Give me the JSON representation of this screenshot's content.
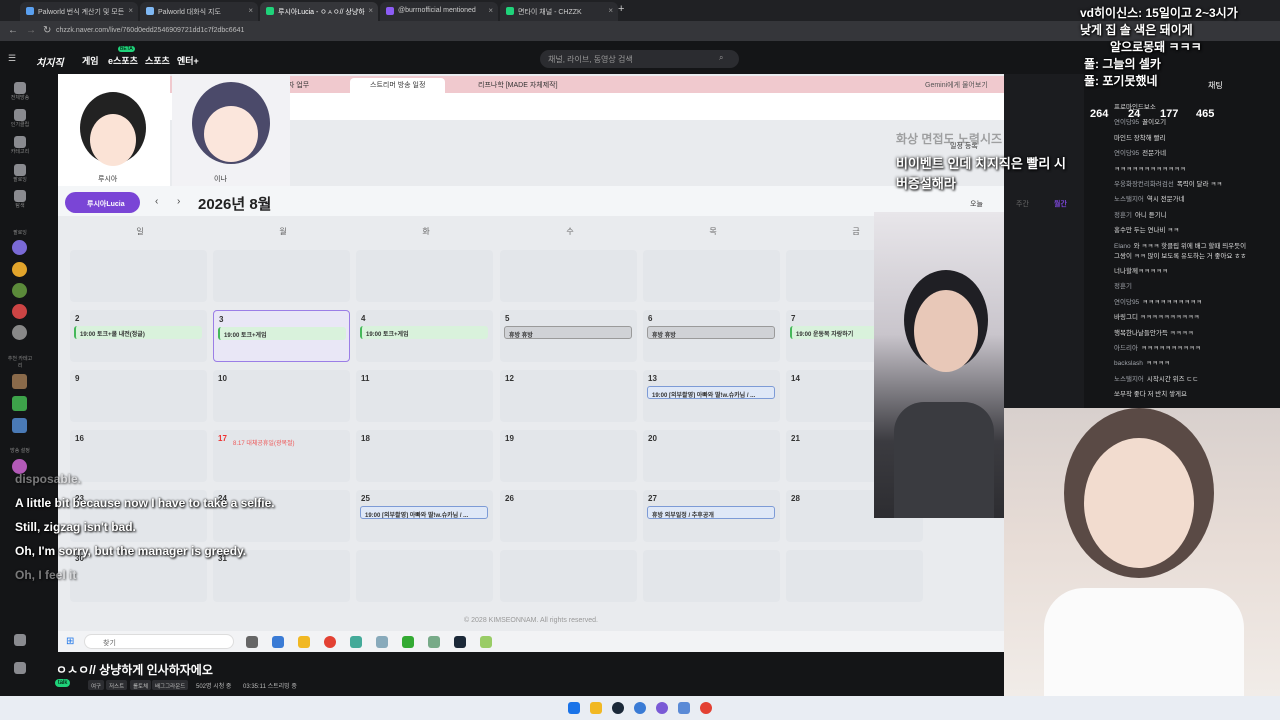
{
  "browser": {
    "tabs": [
      {
        "label": "Palworld 번식 계산기 및 모든",
        "color": "#5aa0f0"
      },
      {
        "label": "Palworld 대화식 지도",
        "color": "#7fb8f4"
      },
      {
        "label": "루시아Lucia - ㅇㅅㅇ// 상냥하",
        "color": "#1fd37a",
        "active": true
      },
      {
        "label": "@burrnofficial mentioned",
        "color": "#8c5cf5"
      },
      {
        "label": "면타이 채널 - CHZZK",
        "color": "#1fd37a"
      }
    ],
    "url": "chzzk.naver.com/live/760d0edd2546909721dd1c7f2dbc6641",
    "new_tab": "+"
  },
  "nav": {
    "logo": "치지직",
    "items": [
      "게임",
      "e스포츠",
      "스포츠",
      "엔터+"
    ],
    "beta_badge": "BETA",
    "search_placeholder": "채널, 라이브, 동영상 검색"
  },
  "rail": {
    "items": [
      "전체방송",
      "인기클립",
      "카테고리",
      "팔로잉",
      "탐색"
    ],
    "section_follow": "팔로잉",
    "section_rec": "추천 카테고리",
    "section_channel": "방송 설정"
  },
  "video": {
    "browser_tabs": [
      "협업자 업무",
      "스트리머 방송 일정",
      "리프나학 [MADE 자체제작]"
    ],
    "gemini_btn": "Gemini에게 물어보기",
    "char_labels": [
      "루시아",
      "이나"
    ],
    "user_pill": "루시아Lucia",
    "month": "2026년 8월",
    "view_buttons": [
      "주간",
      "월간"
    ],
    "today_btn": "오늘",
    "register_btn": "일정 등록",
    "day_headers": [
      "일",
      "월",
      "화",
      "수",
      "목",
      "금"
    ],
    "weeks": [
      [
        {
          "d": ""
        },
        {
          "d": ""
        },
        {
          "d": ""
        },
        {
          "d": ""
        },
        {
          "d": ""
        },
        {
          "d": ""
        }
      ],
      [
        {
          "d": "2",
          "ev": "19:00 토크+쿨 내전(정글)",
          "t": "green"
        },
        {
          "d": "3",
          "ev": "19:00 토크+게임",
          "t": "green",
          "hl": true
        },
        {
          "d": "4",
          "ev": "19:00 토크+게임",
          "t": "green"
        },
        {
          "d": "5",
          "ev": "휴방 휴방",
          "t": "gray"
        },
        {
          "d": "6",
          "ev": "휴방 휴방",
          "t": "gray"
        },
        {
          "d": "7",
          "ev": "19:00 운동복 자랑하기",
          "t": "green"
        }
      ],
      [
        {
          "d": "9"
        },
        {
          "d": "10"
        },
        {
          "d": "11"
        },
        {
          "d": "12"
        },
        {
          "d": "13",
          "ev": "19:00 [외부촬영] 아빠와 딸!w.슈카님 / ...",
          "t": "blue"
        },
        {
          "d": "14"
        }
      ],
      [
        {
          "d": "16"
        },
        {
          "d": "17",
          "red": true,
          "ev": "8.17 대체공휴일(광복절)",
          "t": "redtxt"
        },
        {
          "d": "18"
        },
        {
          "d": "19"
        },
        {
          "d": "20"
        },
        {
          "d": "21"
        }
      ],
      [
        {
          "d": "23"
        },
        {
          "d": "24"
        },
        {
          "d": "25",
          "ev": "19:00 [외부촬영] 아빠와 딸!w.슈카님 / ...",
          "t": "blue"
        },
        {
          "d": "26"
        },
        {
          "d": "27",
          "ev": "휴방 외부일정 / 추후공개",
          "t": "blue"
        },
        {
          "d": "28"
        }
      ],
      [
        {
          "d": "30"
        },
        {
          "d": "31"
        },
        {
          "d": ""
        },
        {
          "d": ""
        },
        {
          "d": ""
        },
        {
          "d": ""
        }
      ]
    ],
    "overlay_text": [
      "비이벤트 인데 치지직은 빨리 시",
      "버증설해라"
    ],
    "overlay_faint": "화상 면접도 노력시즈",
    "footer": "© 2028 KIMSEONNAM. All rights reserved.",
    "taskbar_search": "찾기",
    "subtitles": [
      {
        "text": "disposable.",
        "faint": true
      },
      {
        "text": "A little bit because now I have to take a selfie.",
        "faint": false
      },
      {
        "text": "Still, zigzag isn't bad.",
        "faint": false
      },
      {
        "text": "Oh, I'm sorry, but the manager is greedy.",
        "faint": false
      },
      {
        "text": "Oh, I feel it",
        "faint": true
      }
    ]
  },
  "stream": {
    "title": "ㅇㅅㅇ// 상냥하게 인사하자에오",
    "talk": "talk",
    "tags": [
      "여구",
      "저스트",
      "롤토체",
      "배그그라운드"
    ],
    "viewers": "502명 시청 중",
    "uptime": "03:35:11 스트리밍 중"
  },
  "chat": {
    "header": "채팅",
    "stats": {
      "a": "264",
      "b": "24",
      "c": "177",
      "d": "465"
    },
    "overlay": [
      "vd히이신스: 15일이고 2~3시가",
      "낮게 집 솔 색은 돼이게",
      "알으로몽돼 ㅋㅋㅋ",
      "풀: 그늘의 셀카",
      "풀: 포기못했네"
    ],
    "lines": [
      {
        "nick": "",
        "msg": "프로마인드보소"
      },
      {
        "nick": "연이당95",
        "msg": "꿀이오기"
      },
      {
        "nick": "",
        "msg": "마인드 장착해 빨리"
      },
      {
        "nick": "연이당95",
        "msg": "전문가네"
      },
      {
        "nick": "",
        "msg": "ㅋㅋㅋㅋㅋㅋㅋㅋㅋㅋㅋㅋ"
      },
      {
        "nick": "우웅화장컨리화려검선",
        "msg": "폭력이 달라 ㅋㅋ"
      },
      {
        "nick": "노스탤지어",
        "msg": "역시 전문가네"
      },
      {
        "nick": "정훈기",
        "msg": "아니 듣기니"
      },
      {
        "nick": "",
        "msg": "홍수만 두는 연나비 ㅋㅋ"
      },
      {
        "nick": "Elano",
        "msg": "와 ㅋㅋㅋ 핫클립 위에 배그 할때 띄우듯이"
      },
      {
        "nick": "",
        "msg": "그쌍이 ㅋㅋ 많이 보도록 유도하는 거 좋아요 ㅎㅎ"
      },
      {
        "nick": "",
        "msg": "너나할께ㅋㅋㅋㅋㅋ"
      },
      {
        "nick": "정훈기",
        "msg": ""
      },
      {
        "nick": "연이당95",
        "msg": "ㅋㅋㅋㅋㅋㅋㅋㅋㅋㅋ"
      },
      {
        "nick": "",
        "msg": "바링그디 ㅋㅋㅋㅋㅋㅋㅋㅋㅋㅋ"
      },
      {
        "nick": "",
        "msg": "행복한나날들안가득 ㅋㅋㅋㅋ"
      },
      {
        "nick": "아드리아",
        "msg": "ㅋㅋㅋㅋㅋㅋㅋㅋㅋㅋ"
      },
      {
        "nick": "backslash",
        "msg": "ㅋㅋㅋㅋ"
      },
      {
        "nick": "노스탤지어",
        "msg": "시작시간 위즈 ㄷㄷ"
      },
      {
        "nick": "",
        "msg": "쏘부작 좋다 저 반치 쌓게요"
      }
    ]
  }
}
